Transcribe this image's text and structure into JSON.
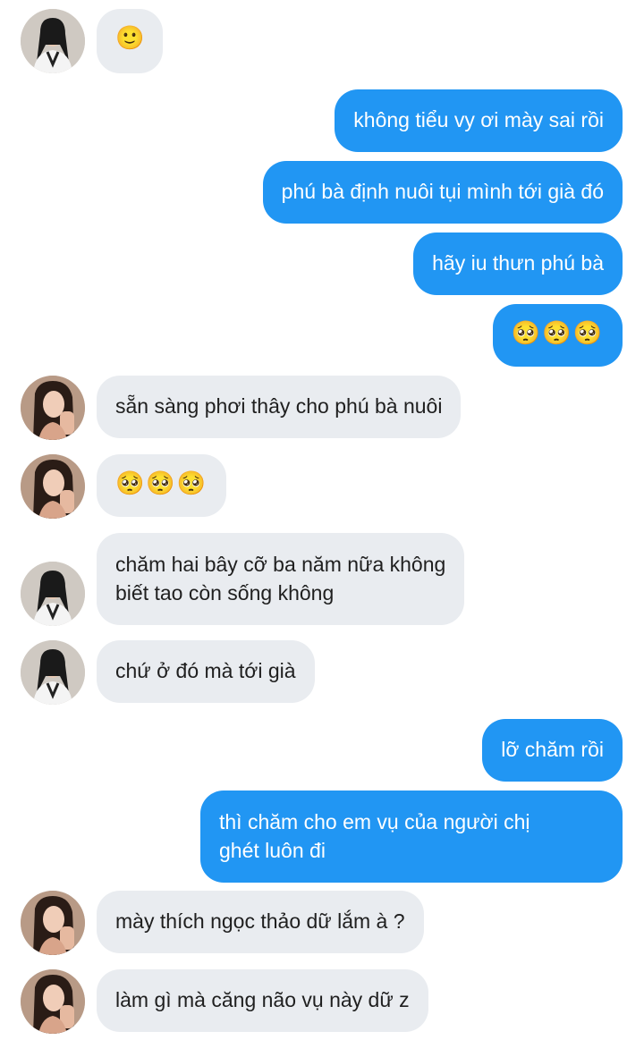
{
  "conversation": {
    "messages": [
      {
        "direction": "in",
        "avatar": "avatar-a",
        "text": "🙂"
      },
      {
        "direction": "out",
        "text": "không tiểu vy ơi mày sai rồi"
      },
      {
        "direction": "out",
        "text": "phú bà định nuôi tụi mình tới già đó"
      },
      {
        "direction": "out",
        "text": "hãy iu thưn phú bà"
      },
      {
        "direction": "out",
        "text": "🥺🥺🥺"
      },
      {
        "direction": "in",
        "avatar": "avatar-b",
        "text": "sẵn sàng phơi thây cho phú bà nuôi"
      },
      {
        "direction": "in",
        "avatar": "avatar-b",
        "text": "🥺🥺🥺"
      },
      {
        "direction": "in",
        "avatar": "avatar-a",
        "line1": "chăm hai bây cỡ ba năm nữa không",
        "line2": "biết tao còn sống không"
      },
      {
        "direction": "in",
        "avatar": "avatar-a",
        "text": "chứ ở đó mà tới già"
      },
      {
        "direction": "out",
        "text": "lỡ chăm rồi"
      },
      {
        "direction": "out",
        "line1": "thì chăm cho em vụ của người chị",
        "line2": "ghét luôn đi"
      },
      {
        "direction": "in",
        "avatar": "avatar-b",
        "text": "mày thích ngọc thảo dữ lắm à ?"
      },
      {
        "direction": "in",
        "avatar": "avatar-b",
        "text": "làm gì mà căng não vụ này dữ z"
      }
    ]
  },
  "colors": {
    "incoming_bubble": "#e9ecf0",
    "outgoing_bubble": "#2196f3"
  }
}
